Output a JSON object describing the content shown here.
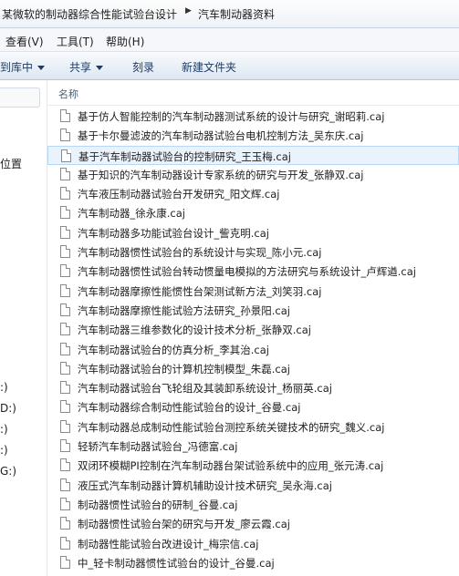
{
  "address_bar": {
    "crumb_parent": "某微软的制动器综合性能试验台设计",
    "crumb_current": "汽车制动器资料"
  },
  "menu": {
    "view": "查看(V)",
    "tools": "工具(T)",
    "help": "帮助(H)"
  },
  "toolbar": {
    "library": "到库中",
    "share": "共享",
    "burn": "刻录",
    "new_folder": "新建文件夹"
  },
  "nav": {
    "location": "位置",
    "drives": [
      ":)",
      "D:)",
      ":)",
      ":)",
      "G:)"
    ]
  },
  "column_header": "名称",
  "files": [
    "基于仿人智能控制的汽车制动器测试系统的设计与研究_谢昭莉.caj",
    "基于卡尔曼滤波的汽车制动器试验台电机控制方法_吴东庆.caj",
    "基于汽车制动器试验台的控制研究_王玉梅.caj",
    "基于知识的汽车制动器设计专家系统的研究与开发_张静双.caj",
    "汽车液压制动器试验台开发研究_阳文辉.caj",
    "汽车制动器_徐永康.caj",
    "汽车制动器多功能试验台设计_訾克明.caj",
    "汽车制动器惯性试验台的系统设计与实现_陈小元.caj",
    "汽车制动器惯性试验台转动惯量电模拟的方法研究与系统设计_卢辉遒.caj",
    "汽车制动器摩擦性能惯性台架测试新方法_刘笑羽.caj",
    "汽车制动器摩擦性能试验方法研究_孙景阳.caj",
    "汽车制动器三维参数化的设计技术分析_张静双.caj",
    "汽车制动器试验台的仿真分析_李其治.caj",
    "汽车制动器试验台的计算机控制模型_朱磊.caj",
    "汽车制动器试验台飞轮组及其装卸系统设计_杨丽英.caj",
    "汽车制动器综合制动性能试验台的设计_谷曼.caj",
    "汽车制动器总成制动性能试验台测控系统关键技术的研究_魏义.caj",
    "轻轿汽车制动器试验台_冯德富.caj",
    "双闭环模糊PI控制在汽车制动器台架试验系统中的应用_张元涛.caj",
    "液压式汽车制动器计算机辅助设计技术研究_吴永海.caj",
    "制动器惯性试验台的研制_谷曼.caj",
    "制动器惯性试验台架的研究与开发_廖云霞.caj",
    "制动器性能试验台改进设计_梅宗信.caj",
    "中_轻卡制动器惯性试验台的设计_谷曼.caj"
  ],
  "selected_index": 2
}
